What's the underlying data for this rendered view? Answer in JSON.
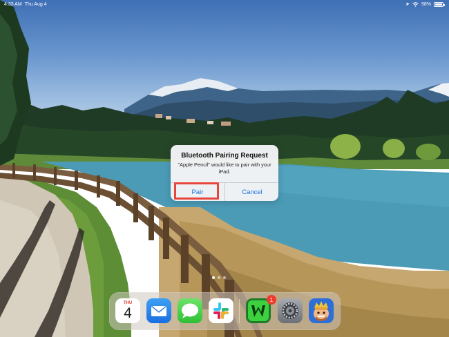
{
  "status_bar": {
    "time": "4:33 AM",
    "date": "Thu Aug 4",
    "battery": "98%"
  },
  "alert": {
    "title": "Bluetooth Pairing Request",
    "message": "\"Apple Pencil\" would like to pair with your iPad.",
    "pair_label": "Pair",
    "cancel_label": "Cancel"
  },
  "dock": {
    "calendar": {
      "weekday": "THU",
      "day": "4"
    },
    "apps": [
      {
        "name": "Calendar",
        "icon": "calendar-icon"
      },
      {
        "name": "Mail",
        "icon": "mail-icon"
      },
      {
        "name": "Messages",
        "icon": "messages-icon"
      },
      {
        "name": "Slack",
        "icon": "slack-icon"
      },
      {
        "name": "Wordament",
        "icon": "w-game-icon",
        "badge": "1"
      },
      {
        "name": "Settings",
        "icon": "settings-icon"
      },
      {
        "name": "Clash Royale",
        "icon": "clash-royale-icon"
      }
    ]
  },
  "colors": {
    "accent": "#1a6fe0",
    "highlight": "#e8453c",
    "badge": "#f03a2f"
  }
}
